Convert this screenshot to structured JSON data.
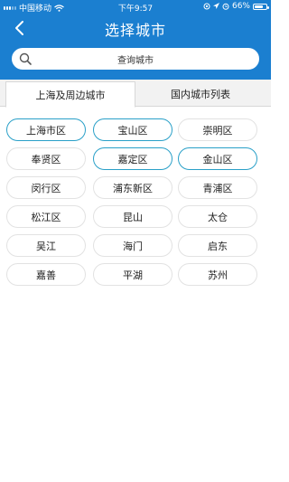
{
  "status_bar": {
    "carrier": "中国移动",
    "time": "下午9:57",
    "battery": "66%"
  },
  "header": {
    "title": "选择城市"
  },
  "search": {
    "placeholder": "查询城市"
  },
  "tabs": [
    {
      "label": "上海及周边城市",
      "active": true
    },
    {
      "label": "国内城市列表",
      "active": false
    }
  ],
  "cities": [
    {
      "label": "上海市区",
      "selected": true
    },
    {
      "label": "宝山区",
      "selected": true
    },
    {
      "label": "崇明区",
      "selected": false
    },
    {
      "label": "奉贤区",
      "selected": false
    },
    {
      "label": "嘉定区",
      "selected": true
    },
    {
      "label": "金山区",
      "selected": true
    },
    {
      "label": "闵行区",
      "selected": false
    },
    {
      "label": "浦东新区",
      "selected": false
    },
    {
      "label": "青浦区",
      "selected": false
    },
    {
      "label": "松江区",
      "selected": false
    },
    {
      "label": "昆山",
      "selected": false
    },
    {
      "label": "太仓",
      "selected": false
    },
    {
      "label": "吴江",
      "selected": false
    },
    {
      "label": "海门",
      "selected": false
    },
    {
      "label": "启东",
      "selected": false
    },
    {
      "label": "嘉善",
      "selected": false
    },
    {
      "label": "平湖",
      "selected": false
    },
    {
      "label": "苏州",
      "selected": false
    }
  ],
  "colors": {
    "header": "#1b7fd0",
    "selected_border": "#2aa0c8",
    "chip_border": "#e2e2e2"
  }
}
